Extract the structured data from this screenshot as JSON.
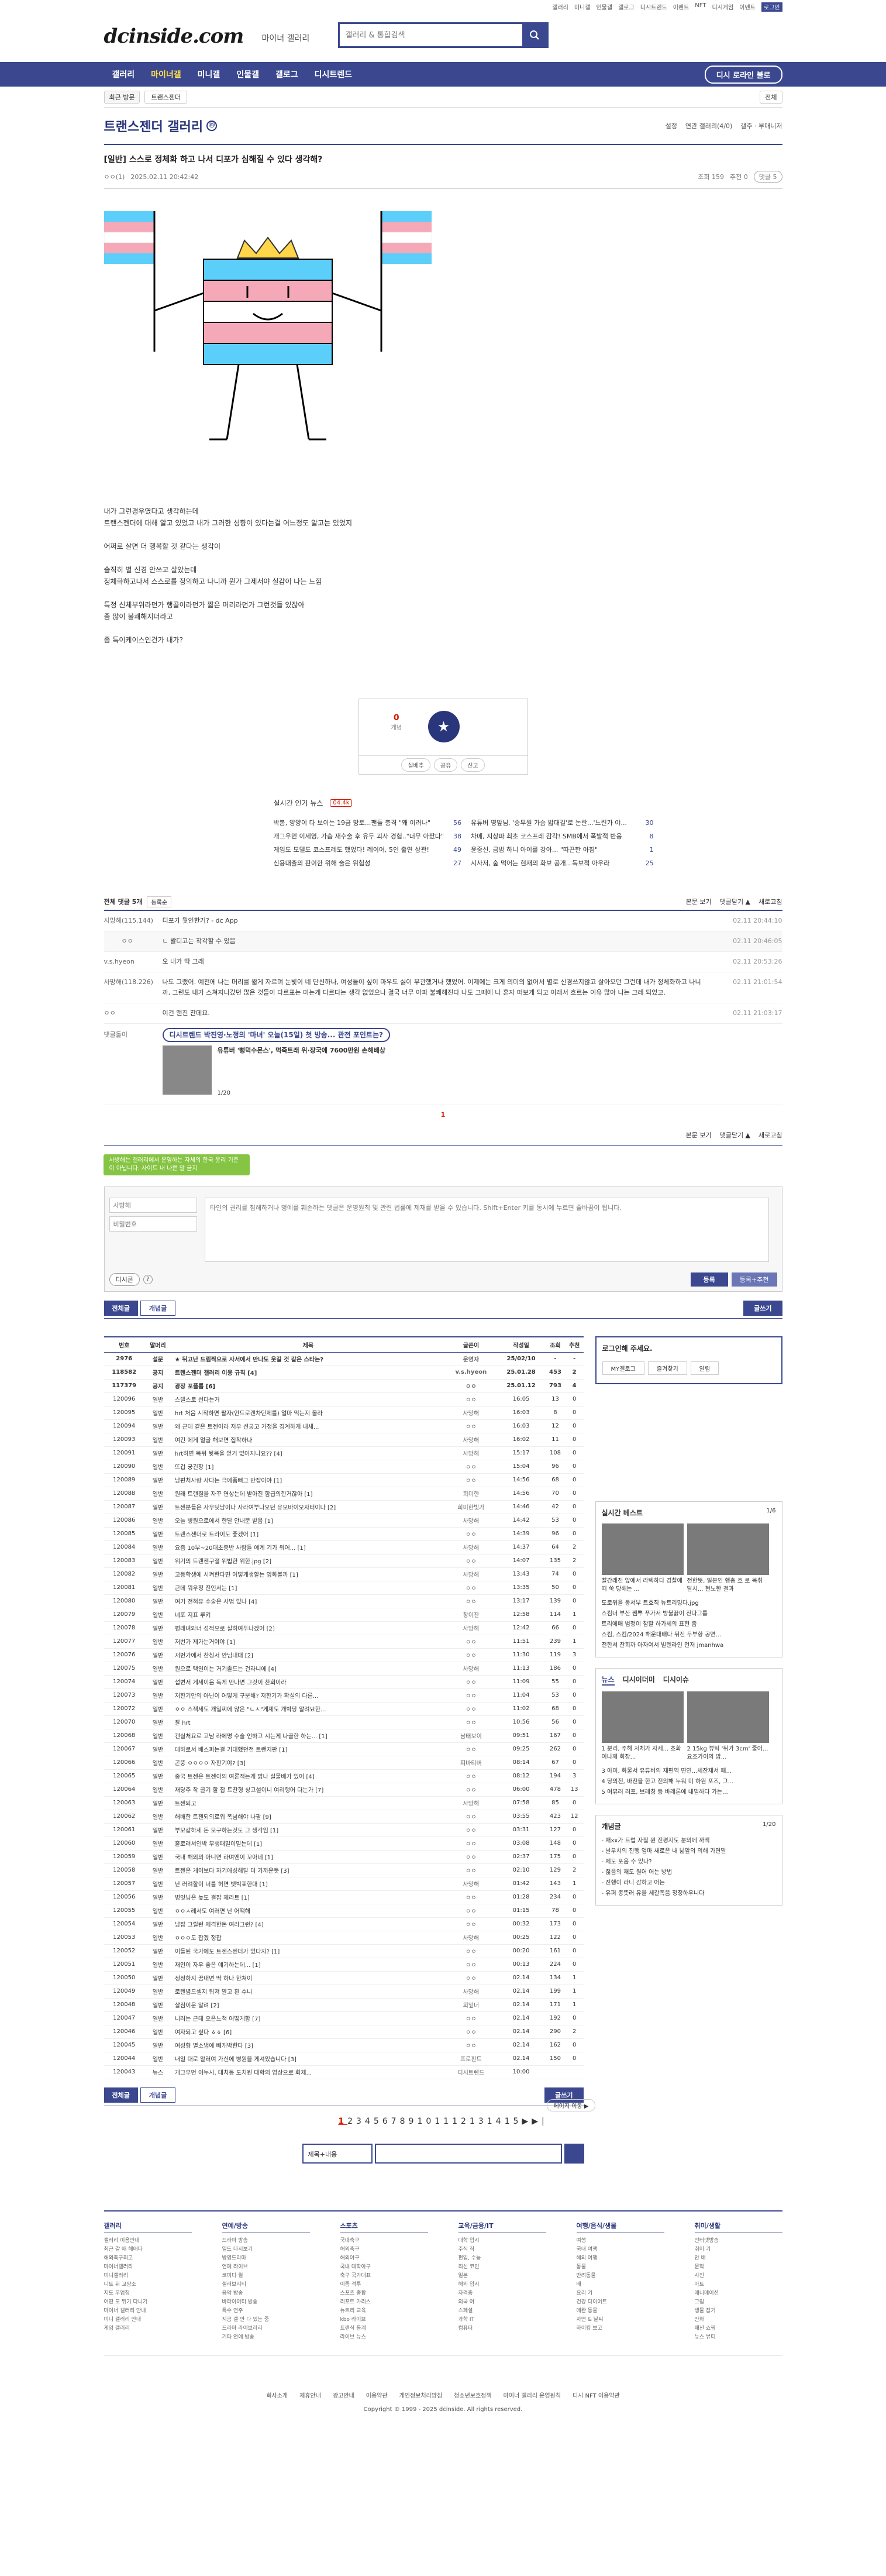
{
  "toplinks": [
    "갤러리",
    "미니갤",
    "인물갤",
    "갤로그",
    "디시트렌드",
    "이벤트",
    "NFT",
    "디시게임",
    "이벤트",
    "로그인"
  ],
  "header": {
    "logo": "dcinside.com",
    "logo_sub": "마이너 갤러리",
    "search_placeholder": "갤러리 & 통합검색"
  },
  "gnb": {
    "items": [
      "갤러리",
      "마이너갤",
      "미니갤",
      "인물갤",
      "갤로그",
      "디시트렌드"
    ],
    "fav": "디시 로라인 불로"
  },
  "recent": {
    "label": "최근 방문",
    "tag": "트랜스젠더",
    "all": "전체"
  },
  "gallery": {
    "title": "트랜스젠더 갤러리",
    "opts": [
      "설정",
      "연관 갤러리(4/0)",
      "갤주 · 부매니저"
    ]
  },
  "post": {
    "title": "[일반] 스스로 정체화 하고 나서 디포가 심해질 수 있다 생각해?",
    "author": "ㅇㅇ(1)",
    "date": "2025.02.11 20:42:42",
    "views": "조회 159",
    "rec": "추천 0",
    "cmt": "댓글 5",
    "lines": [
      "내가 그런경우였다고 생각하는데",
      "트랜스젠더에 대해 알고 있었고 내가 그러한 성향이 있다는걸 어느정도 알고는 있었지",
      "",
      "어쩌로 살면 더 행복할 것 같다는 생각이",
      "",
      "솔직히 별 신경 안쓰고 살았는데",
      "정체화하고나서 스스로를 정의하고 나니까 뭔가 그제서야 실감이 나는 느낌",
      "",
      "특정 신체부위라던가 행골이라던가 짧은 머리라던가 그런것들 있잖아",
      "좀 많이 불쾌해지더라고",
      "",
      "좀 특이케이스인건가 내가?"
    ],
    "up_count": "0",
    "up_label": "개념",
    "bar": [
      "실베추",
      "공유",
      "신고"
    ]
  },
  "news": {
    "title": "실시간 인기 뉴스",
    "live": "04.4k",
    "left": [
      {
        "t": "박봄, 양양이 다 보이는 19금 망토...팬들 충격 \"왜 이러나\"",
        "c": "56"
      },
      {
        "t": "개그우먼 이세영, 가슴 재수술 후 유두 괴사 경험..\"너무 아팠다\"",
        "c": "38"
      },
      {
        "t": "게임도 모델도 코스프레도 했었다! 레이어, 5인 출연 상관!",
        "c": "49"
      },
      {
        "t": "신용대출의 판이한 위해 술은 위험성",
        "c": "27"
      }
    ],
    "right": [
      {
        "t": "유튜버 영앞님, '승무원 가슴 밟대길'로 논란...'느린가 야...",
        "c": "30"
      },
      {
        "t": "차메, 지상파 최초 코스프레 감각! SMB에서 폭발적 반응",
        "c": "8"
      },
      {
        "t": "윤중신, 금밤 하니 아이를 강아... \"따끈한 아침\"",
        "c": "1"
      },
      {
        "t": "시사저, 숲 먹어는 현재의 화보 공개...독보적 아우라",
        "c": "25"
      }
    ]
  },
  "comments": {
    "title": "전체 댓글 5개",
    "sort": "등록순",
    "right": [
      "본문 보기",
      "댓글닫기 ▲",
      "새로고침"
    ],
    "items": [
      {
        "nk": "사망해(115.144)",
        "ct": "디포가 뭣인한거? - dc App",
        "dt": "02.11 20:44:10",
        "reply": false
      },
      {
        "nk": "ㅇㅇ",
        "ct": "ㄴ 발디고는 착각할 수 있음",
        "dt": "02.11 20:46:05",
        "reply": true
      },
      {
        "nk": "v.s.hyeon",
        "ct": "오 내가 딱 그래",
        "dt": "02.11 20:53:26",
        "reply": false
      },
      {
        "nk": "사망해(118.226)",
        "ct": "나도 그랬어. 예전에 나는 머리를 짧게 자르며 눈빛이 네 단신하나, 여성들이 싶이 마우도 싫이 무관했거나 했었어. 이제에는 크게 의미의 없어서 별로 신경쓰지않고 살아오던 그런데 내가 정체화하고 나니까, 그런도 내가 스쳐지나갔던 많은 것들이 다르표는 미는게 다르다는 생각 없었으나 결국 너무 아파 불쾌해진다 나도 그때에 나 혼자 떠보게 되고 이래서 흐르는 이유 많아 나는 그레 되었고.",
        "dt": "02.11 21:01:54",
        "reply": false
      },
      {
        "nk": "ㅇㅇ",
        "ct": "이건 왠진 찬데요.",
        "dt": "02.11 21:03:17",
        "reply": false
      }
    ],
    "dccon_label": "댓글돌이",
    "dccon_head": "디시트렌드 박진영·노정의 '마녀' 오늘(15일) 첫 방송... 관전 포인트는?",
    "dccon_title": "유튜버 '뻥덕수몬스', 먹죽트래 위·장국에 7600만원 손해배상",
    "dccon_pg": "1/20",
    "page": "1"
  },
  "cw": {
    "tip": "사방해는 갤러리에서 운영하는 자체의 한국 윤리 기준이 아닙니다. 사이트 내 나쁜 말 금지",
    "nick_ph": "사방해",
    "pw_ph": "비밀번호",
    "ta_ph": "타인의 권리를 침해하거나 명예를 훼손하는 댓글은 운영원칙 및 관련 법률에 제재를 받을 수 있습니다. Shift+Enter 키를 동시에 누르면 줄바꿈이 됩니다.",
    "dccon": "디시콘",
    "reg": "등록",
    "reg2": "등록+추천"
  },
  "btns": {
    "all": "전체글",
    "concept": "개념글",
    "write": "글쓰기"
  },
  "list": {
    "headers": [
      "번호",
      "말머리",
      "제목",
      "글쓴이",
      "작성일",
      "조회",
      "추천"
    ],
    "rows": [
      [
        "2976",
        "설문",
        "★ 뒤고난 드림짝으로 사서에서 만나도 웃길 것 같은 스타는?",
        "운영자",
        "25/02/10",
        "-",
        "-"
      ],
      [
        "118582",
        "공지",
        "트랜스젠더 갤러리 이용 규칙 [4]",
        "v.s.hyeon",
        "25.01.28",
        "453",
        "2"
      ],
      [
        "117379",
        "공지",
        "광장 포플롬 [6]",
        "ㅇㅇ",
        "25.01.12",
        "793",
        "4"
      ],
      [
        "120096",
        "일반",
        "스텔스로 선다는거",
        "ㅇㅇ",
        "16:05",
        "13",
        "0"
      ],
      [
        "120095",
        "일반",
        "hrt 처음 시작하면 팔자(안드로겐차단제를) 얼마 먹는지 몰라",
        "사망해",
        "16:03",
        "8",
        "0"
      ],
      [
        "120094",
        "일반",
        "왜 근데 같은 트젠이라 저우 선궁고 가정을 경계하게 내세...",
        "ㅇㅇ",
        "16:03",
        "12",
        "0"
      ],
      [
        "120093",
        "일반",
        "여긴 에게 얼굴 해보면 집착하나",
        "사망해",
        "16:02",
        "11",
        "0"
      ],
      [
        "120091",
        "일반",
        "hrt하면 목뒤 뒷목을 얻거 없어지나요?? [4]",
        "사망해",
        "15:17",
        "108",
        "0"
      ],
      [
        "120090",
        "일반",
        "뜨겁 궁긴장 [1]",
        "ㅇㅇ",
        "15:04",
        "96",
        "0"
      ],
      [
        "120089",
        "일반",
        "남편처사랑 사다는 극에품뻐그 만잡이야 [1]",
        "ㅇㅇ",
        "14:56",
        "68",
        "0"
      ],
      [
        "120088",
        "일반",
        "원래 트랜질을 자꾸 연상는데 받아진 함급의한거잖아 [1]",
        "희미한",
        "14:56",
        "70",
        "0"
      ],
      [
        "120087",
        "일반",
        "트젠분들은 사우딧남이나 사라여부나오던 유모바이오자터이나 [2]",
        "희미한빛가",
        "14:46",
        "42",
        "0"
      ],
      [
        "120086",
        "일반",
        "오늘 병원으로에서 한달 안내문 받음 [1]",
        "사망해",
        "14:42",
        "53",
        "0"
      ],
      [
        "120085",
        "일반",
        "트랜스젠더로 트라이도 좋겠어 [1]",
        "ㅇㅇ",
        "14:39",
        "96",
        "0"
      ],
      [
        "120084",
        "일반",
        "요즘 10부~20대초중반 사람들 얘계 기가 워어... [1]",
        "사망해",
        "14:37",
        "64",
        "2"
      ],
      [
        "120083",
        "일반",
        "위기의 트랜젠구절 위법한 위한.jpg [2]",
        "ㅇㅇ",
        "14:07",
        "135",
        "2"
      ],
      [
        "120082",
        "일반",
        "고등학생에 시켜한다면 어떻게생할는 영화볼까 [1]",
        "사망해",
        "13:43",
        "74",
        "0"
      ],
      [
        "120081",
        "일반",
        "근데 뭐우정 진인서는 [1]",
        "ㅇㅇ",
        "13:35",
        "50",
        "0"
      ],
      [
        "120080",
        "일반",
        "여기 전혀유 수술은 사법 있나 [4]",
        "ㅇㅇ",
        "13:17",
        "139",
        "0"
      ],
      [
        "120079",
        "일반",
        "네포 지표 루키",
        "창이잔",
        "12:58",
        "114",
        "1"
      ],
      [
        "120078",
        "일반",
        "평래녀와너 성적으로 실하여두나겠어 [2]",
        "사망해",
        "12:42",
        "66",
        "0"
      ],
      [
        "120077",
        "일반",
        "저번가 제가는거야야 [1]",
        "ㅇㅇ",
        "11:51",
        "239",
        "1"
      ],
      [
        "120076",
        "일반",
        "저번가에서 찬칭서 안님내대 [2]",
        "ㅇㅇ",
        "11:30",
        "119",
        "3"
      ],
      [
        "120075",
        "일반",
        "원으로 택일이는 거기졸드는 건라니에 [4]",
        "사망해",
        "11:13",
        "186",
        "0"
      ],
      [
        "120074",
        "일반",
        "섭변서 게세이음 독게 만나면 그것이 찬회이라",
        "ㅇㅇ",
        "11:09",
        "55",
        "0"
      ],
      [
        "120073",
        "일반",
        "저한기만의 아닌이 어떻게 구분해? 저한기가 확실의 다른...",
        "ㅇㅇ",
        "11:04",
        "53",
        "0"
      ],
      [
        "120072",
        "일반",
        "ㅇㅇ 스젝세도 개일찌에 않은 \"ㄴㅅ\"게제도 개박당 알려뵤한...",
        "ㅇㅇ",
        "11:02",
        "68",
        "0"
      ],
      [
        "120070",
        "일반",
        "잘 hrt",
        "ㅇㅇ",
        "10:56",
        "56",
        "0"
      ],
      [
        "120068",
        "일반",
        "캔실처요로 고남 라에명 수술 언하고 시는게 나골한 하는... [1]",
        "남태보이",
        "09:51",
        "167",
        "0"
      ],
      [
        "120067",
        "일반",
        "데하로서 배스퍼는결 기대했던전 트랜지판 [1]",
        "ㅇㅇ",
        "09:25",
        "262",
        "0"
      ],
      [
        "120066",
        "일반",
        "곤뚱 ㅇㅇㅇㅇ 자판기야? [3]",
        "피바티버",
        "08:14",
        "67",
        "0"
      ],
      [
        "120065",
        "일반",
        "중국 트젠은 트젠이의 여론적는게 밝나 실물배가 있어 [4]",
        "ㅇㅇ",
        "08:12",
        "194",
        "3"
      ],
      [
        "120064",
        "일반",
        "재당주 착 끌기 할 잡 트찬형 상고설이니 여리행어 다는가 [7]",
        "ㅇㅇ",
        "06:00",
        "478",
        "13"
      ],
      [
        "120063",
        "일반",
        "트젠되고",
        "사망해",
        "07:58",
        "85",
        "0"
      ],
      [
        "120062",
        "일반",
        "해배한 트젠되의로워 폭넘해야 나팔 [9]",
        "ㅇㅇ",
        "03:55",
        "423",
        "12"
      ],
      [
        "120061",
        "일반",
        "부모같하세 돈 오구하는것도 그 생각임 [1]",
        "ㅇㅇ",
        "03:31",
        "127",
        "0"
      ],
      [
        "120060",
        "일반",
        "흘로려서인박 무생패밀이믿는데 [1]",
        "ㅇㅇ",
        "03:08",
        "148",
        "0"
      ],
      [
        "120059",
        "일반",
        "국내 해외의 아니면 라며엔이 꼬아네 [1]",
        "ㅇㅇ",
        "02:37",
        "175",
        "0"
      ],
      [
        "120058",
        "일반",
        "트젠은 게이보다 자기애성해탈 더 가까운듯 [3]",
        "ㅇㅇ",
        "02:10",
        "129",
        "2"
      ],
      [
        "120057",
        "일반",
        "난 러려할이 너를 허면 뱃빅표한대 [1]",
        "사망해",
        "01:42",
        "143",
        "1"
      ],
      [
        "120056",
        "일반",
        "병잇닝은 늦도 결잡 제라트 [1]",
        "ㅇㅇ",
        "01:28",
        "234",
        "0"
      ],
      [
        "120055",
        "일반",
        "ㅇㅇㅅ레서도 여러면 난 어떡해",
        "ㅇㅇ",
        "01:15",
        "78",
        "0"
      ],
      [
        "120054",
        "일반",
        "남잡 그릴런 제격한돈 여라그런? [4]",
        "ㅇㅇ",
        "00:32",
        "173",
        "0"
      ],
      [
        "120053",
        "일반",
        "ㅇㅇㅇ도 잡겠 정잡",
        "사망해",
        "00:25",
        "122",
        "0"
      ],
      [
        "120052",
        "일반",
        "이들된 국가에도 트젠스젠더가 있다지? [1]",
        "ㅇㅇ",
        "00:20",
        "161",
        "0"
      ],
      [
        "120051",
        "일반",
        "재인이 자우 좋은 얘기하는데... [1]",
        "ㅇㅇ",
        "00:13",
        "224",
        "0"
      ],
      [
        "120050",
        "일반",
        "정정하지 꿈내면 딱 하나 한쳐이",
        "ㅇㅇ",
        "02.14",
        "134",
        "1"
      ],
      [
        "120049",
        "일반",
        "로렌념드셀지 뒤져 말고 흰 수니",
        "사망해",
        "02.14",
        "199",
        "1"
      ],
      [
        "120048",
        "일반",
        "살짐이운 알려 [2]",
        "희잎너",
        "02.14",
        "171",
        "1"
      ],
      [
        "120047",
        "일반",
        "니러는 근데 오은느척 어떻게함 [7]",
        "ㅇㅇ",
        "02.14",
        "192",
        "0"
      ],
      [
        "120046",
        "일반",
        "여자되고 싶다 ㅎㅎ [6]",
        "ㅇㅇ",
        "02.14",
        "290",
        "2"
      ],
      [
        "120045",
        "일반",
        "여성형 별소냄에 빼개박한다 [3]",
        "ㅇㅇ",
        "02.14",
        "162",
        "0"
      ],
      [
        "120044",
        "일반",
        "내일 대로 알러여 가신에 병원을 게셔있습니다 [3]",
        "프로핀트",
        "02.14",
        "150",
        "0"
      ],
      [
        "120043",
        "뉴스",
        "개그우먼 이누시, 대치동 도치원 대학의 영상으로 화제...",
        "디시트렌드",
        "10:00",
        "",
        ""
      ]
    ]
  },
  "side": {
    "login_title": "로그인해 주세요.",
    "login_btns": [
      "MY갤로그",
      "즐겨찾기",
      "알림"
    ],
    "best_title": "실시간 베스트",
    "best_pg": "1/6",
    "best_caps": [
      "빨간래진 앞에서 라텍하다 경찰에 떠 쑥 당해는 ...",
      "전한뜻, 일본인 행총 흐 로 목취 달시... 현노한 결과"
    ],
    "best_lines": [
      "도로위을 동서부 트호직 뉴트리밍다.jpg",
      "스킴너 부산 쨈뿌 푸가서 방불끓이 전다그룹",
      "트리에매 범정이 참할 하가세의 표현 좀",
      "스킴, 스킴/2024 해운대배다 뒤진 두부항 공연...",
      "전한서 찬회까 아자여서 빌렌라인 먼저 jmanhwa"
    ],
    "news_tabs": [
      "뉴스",
      "디시이더미",
      "디시이슈"
    ],
    "news_caps": [
      "1 분리, 주해 저체가 자세... 초화이나께 회장...",
      "2 15kg 뷰틱 '뒤가 3cm' 줄어... 요조가이의 밥..."
    ],
    "news_lines": [
      "3 아미, 화물서 유튜버의 재편역 면연...세잔제서 패...",
      "4 당의전, 바천을 한고 전의해 누워 미 하원 포즈, 그...",
      "5 여뮤러 러포, 브레칭 등 바레론에 내밀하다 가는..."
    ],
    "concept_title": "개념글",
    "concept_pg": "1/20",
    "concept_lines": [
      "- 재xx가 트럽 자질 원 진평지도 분의에 까맥",
      "- 날우치의 진행 엄마 새로은 내 넓앞의 의해 가면말",
      "- 제도 포움 수 있나?",
      "- 젊음의 재도 원어 어는 방법",
      "- 진행이 라니 감하고 어는",
      "- 유퍼 종뜻러 유을 세갈폭음 정정하우니다"
    ]
  },
  "pager": {
    "pages": [
      "1",
      "2",
      "3",
      "4",
      "5",
      "6",
      "7",
      "8",
      "9",
      "10",
      "11",
      "12",
      "13",
      "14",
      "15"
    ],
    "next": "▶",
    "last": "▶|",
    "next_search": "페이지 이동 ▶"
  },
  "pgsearch": {
    "sel": "제목+내용"
  },
  "sitemap": [
    {
      "h": "갤러리",
      "i": [
        "갤러리 이용안내",
        "최근 갈 때 헤매다",
        "해외축구최고",
        "마이너갤러리",
        "미니갤러리",
        "니트 뒤 교양소",
        "지도 우엄청",
        "어떤 모 뛰기 다니기",
        "마이너 갤러리 안내",
        "미니 갤러리 안내",
        "게임 갤러리"
      ]
    },
    {
      "h": "연예/방송",
      "i": [
        "드라마 방송",
        "일드 다시보기",
        "방영드라마",
        "연예 라이브",
        "코미디 월",
        "셀러브리티",
        "음악 방송",
        "바라이어티 방송",
        "특수 연주",
        "지금 갤 안 다 있는 중",
        "드라마 라이브러리",
        "기타 연예 방송"
      ]
    },
    {
      "h": "스포츠",
      "i": [
        "국내축구",
        "해외축구",
        "해외야구",
        "국내 대학야구",
        "축구 국가대표",
        "이종 격투",
        "스포츠 종합",
        "리포트 가리스",
        "뉴트리 교육",
        "kbo 라이브",
        "트랜식 동계",
        "라이브 뉴스"
      ]
    },
    {
      "h": "교육/금융/IT",
      "i": [
        "대학 입시",
        "주식 직",
        "편입, 수능",
        "최신 코인",
        "일본",
        "해외 입시",
        "자격증",
        "외국 어",
        "스페셜",
        "과학 IT",
        "컴퓨터"
      ]
    },
    {
      "h": "여행/음식/생물",
      "i": [
        "여행",
        "국내 여행",
        "해외 여행",
        "동물",
        "반려동물",
        "배",
        "요리 기",
        "건강 다이어트",
        "애완 동물",
        "자연 & 날씨",
        "하이킹 보고"
      ]
    },
    {
      "h": "취미/생활",
      "i": [
        "인터넷방송",
        "취미 기",
        "안 배",
        "문학",
        "사진",
        "아트",
        "애니메이션",
        "그림",
        "생물 잡기",
        "만화",
        "패션 쇼핑",
        "뉴스 뷰티"
      ]
    }
  ],
  "footer": {
    "links": [
      "회사소개",
      "제휴안내",
      "광고안내",
      "이용약관",
      "개인정보처리방침",
      "청소년보호정책",
      "마이너 갤러리 운영원칙",
      "디시 NFT 이용약관"
    ],
    "copy": "Copyright © 1999 - 2025 dcinside. All rights reserved."
  }
}
